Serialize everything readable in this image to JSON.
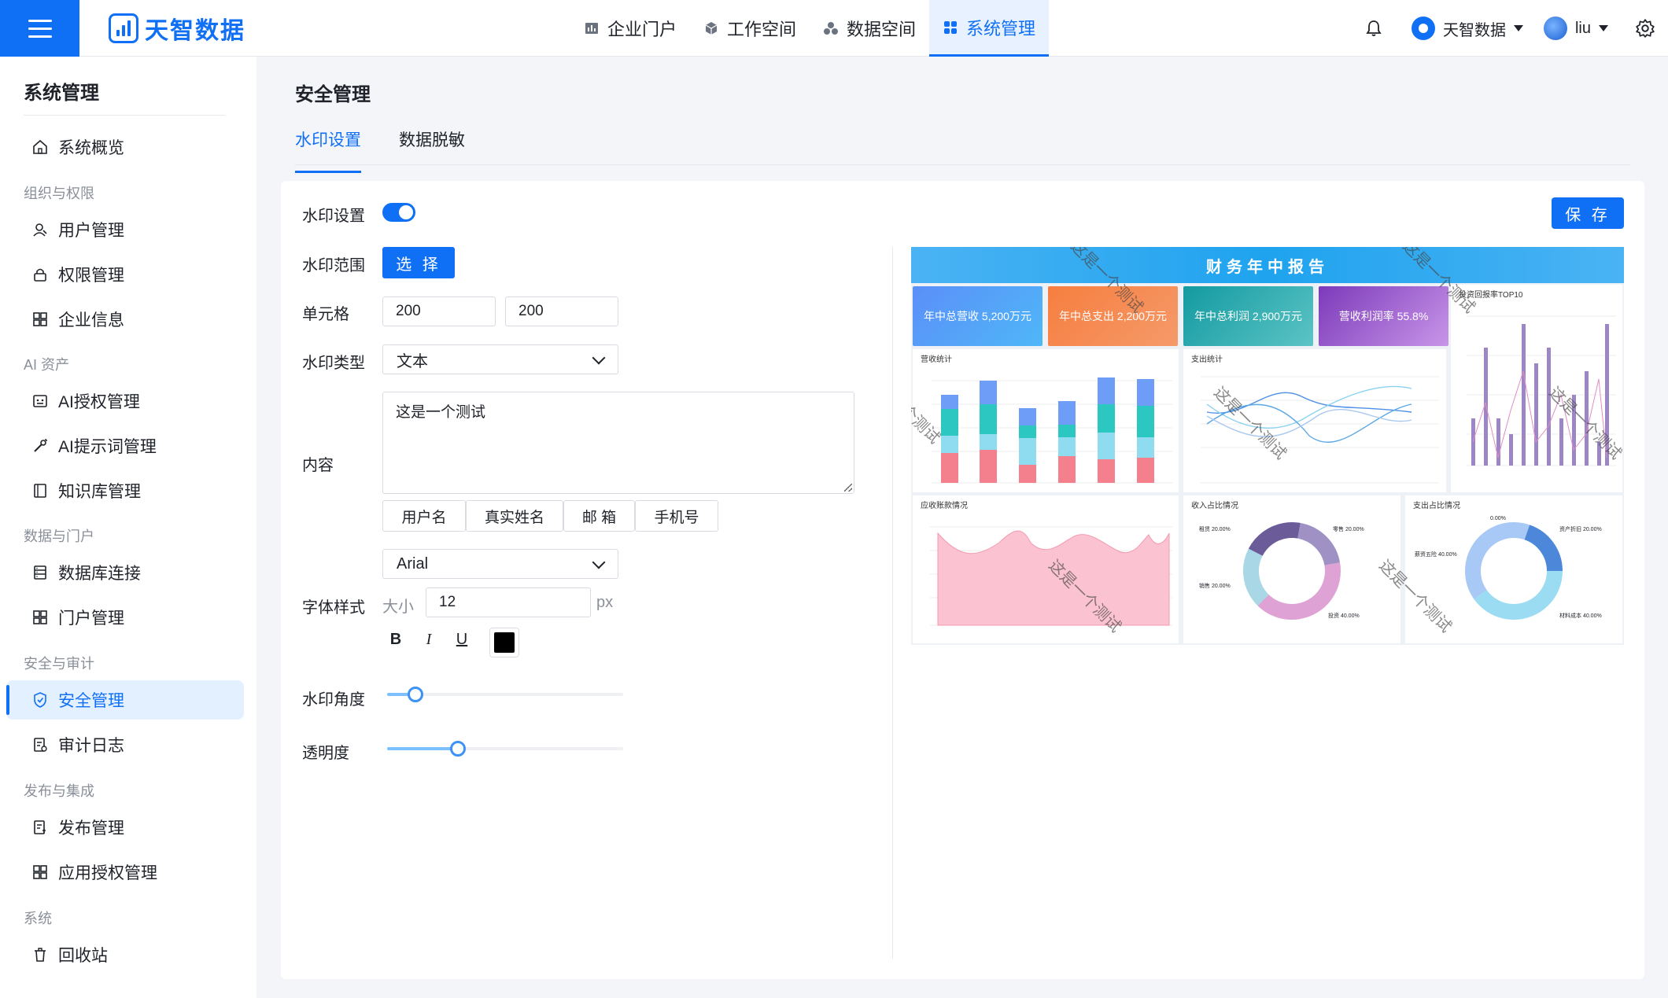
{
  "app": {
    "logo_text": "天智数据",
    "nav": [
      {
        "label": "企业门户",
        "icon": "bar-chart-icon"
      },
      {
        "label": "工作空间",
        "icon": "cube-icon"
      },
      {
        "label": "数据空间",
        "icon": "cubes-icon"
      },
      {
        "label": "系统管理",
        "icon": "grid-icon",
        "active": true
      }
    ],
    "org_name": "天智数据",
    "user_name": "liu"
  },
  "sidebar": {
    "title": "系统管理",
    "items": [
      {
        "type": "item",
        "label": "系统概览",
        "icon": "home-icon"
      },
      {
        "type": "group",
        "label": "组织与权限"
      },
      {
        "type": "item",
        "label": "用户管理",
        "icon": "user-icon"
      },
      {
        "type": "item",
        "label": "权限管理",
        "icon": "lock-icon"
      },
      {
        "type": "item",
        "label": "企业信息",
        "icon": "grid-icon"
      },
      {
        "type": "group",
        "label": "AI 资产"
      },
      {
        "type": "item",
        "label": "AI授权管理",
        "icon": "robot-icon"
      },
      {
        "type": "item",
        "label": "AI提示词管理",
        "icon": "wand-icon"
      },
      {
        "type": "item",
        "label": "知识库管理",
        "icon": "book-icon"
      },
      {
        "type": "group",
        "label": "数据与门户"
      },
      {
        "type": "item",
        "label": "数据库连接",
        "icon": "database-icon"
      },
      {
        "type": "item",
        "label": "门户管理",
        "icon": "grid-icon"
      },
      {
        "type": "group",
        "label": "安全与审计"
      },
      {
        "type": "item",
        "label": "安全管理",
        "icon": "shield-icon",
        "active": true
      },
      {
        "type": "item",
        "label": "审计日志",
        "icon": "log-icon"
      },
      {
        "type": "group",
        "label": "发布与集成"
      },
      {
        "type": "item",
        "label": "发布管理",
        "icon": "publish-icon"
      },
      {
        "type": "item",
        "label": "应用授权管理",
        "icon": "grid-icon"
      },
      {
        "type": "group",
        "label": "系统"
      },
      {
        "type": "item",
        "label": "回收站",
        "icon": "trash-icon"
      }
    ]
  },
  "main": {
    "title": "安全管理",
    "tabs": [
      {
        "label": "水印设置",
        "active": true
      },
      {
        "label": "数据脱敏"
      }
    ],
    "save_label": "保 存",
    "form": {
      "watermark_label": "水印设置",
      "watermark_enabled": true,
      "scope_label": "水印范围",
      "scope_button": "选 择",
      "cell_label": "单元格",
      "cell_width": "200",
      "cell_height": "200",
      "type_label": "水印类型",
      "type_value": "文本",
      "content_label": "内容",
      "content_value": "这是一个测试",
      "tag_buttons": [
        "用户名",
        "真实姓名",
        "邮 箱",
        "手机号"
      ],
      "font_label": "字体样式",
      "font_family_value": "Arial",
      "size_label": "大小",
      "size_value": "12",
      "size_unit": "px",
      "bold": "B",
      "italic": "I",
      "underline": "U",
      "font_color": "#000000",
      "angle_label": "水印角度",
      "angle_fraction": 0.12,
      "opacity_label": "透明度",
      "opacity_fraction": 0.3
    }
  },
  "preview": {
    "header": "财务年中报告",
    "watermark_text": "这是一个测试",
    "kpis": [
      {
        "label": "年中总营收 5,200万元",
        "color": "#5b8ff9"
      },
      {
        "label": "年中总支出 2,200万元",
        "color": "#f6844a"
      },
      {
        "label": "年中总利润 2,900万元",
        "color": "#17a2a7"
      },
      {
        "label": "营收利润率 55.8%",
        "color": "#8f45c7"
      }
    ],
    "cards": {
      "revenue": "营收统计",
      "expense": "支出统计",
      "roi": "投资回报率TOP10",
      "receivable": "应收账款情况",
      "income_share": "收入占比情况",
      "expense_share": "支出占比情况"
    },
    "pie_labels_income": [
      "租赁 20.00%",
      "零售 20.00%",
      "销售 20.00%",
      "投资 40.00%"
    ],
    "pie_labels_expense": [
      "0.00%",
      "资产折旧 20.00%",
      "薪资五险 40.00%",
      "材料成本 40.00%"
    ]
  }
}
